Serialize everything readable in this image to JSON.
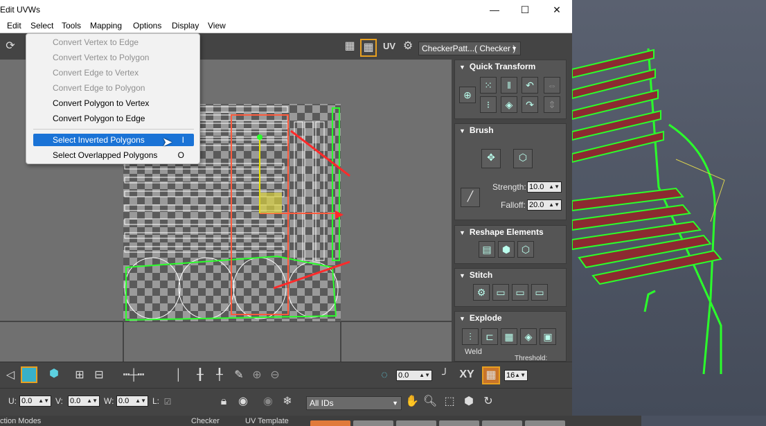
{
  "window": {
    "title": "Edit UVWs",
    "minimize": "—",
    "maximize": "☐",
    "close": "✕"
  },
  "menubar": [
    "Edit",
    "Select",
    "Tools",
    "Mapping",
    "Options",
    "Display",
    "View"
  ],
  "select_menu": {
    "items": [
      {
        "label": "Convert Vertex to Edge",
        "shortcut": "",
        "enabled": false
      },
      {
        "label": "Convert Vertex to Polygon",
        "shortcut": "",
        "enabled": false
      },
      {
        "label": "Convert Edge to Vertex",
        "shortcut": "",
        "enabled": false
      },
      {
        "label": "Convert Edge to Polygon",
        "shortcut": "",
        "enabled": false
      },
      {
        "label": "Convert Polygon to Vertex",
        "shortcut": "",
        "enabled": true
      },
      {
        "label": "Convert Polygon to Edge",
        "shortcut": "",
        "enabled": true
      },
      {
        "label": "Select Inverted Polygons",
        "shortcut": "I",
        "enabled": true,
        "highlighted": true
      },
      {
        "label": "Select Overlapped Polygons",
        "shortcut": "O",
        "enabled": true
      }
    ]
  },
  "toolbar": {
    "uv_label": "UV",
    "texture_combo": "CheckerPatt...( Checker )"
  },
  "rollouts": {
    "quick_transform": "Quick Transform",
    "brush": "Brush",
    "reshape": "Reshape Elements",
    "stitch": "Stitch",
    "explode": "Explode",
    "weld": "Weld",
    "threshold": "Threshold:"
  },
  "brush": {
    "strength_label": "Strength:",
    "strength_value": "10.0",
    "falloff_label": "Falloff:",
    "falloff_value": "20.0"
  },
  "bottom": {
    "rotate_value": "0.0",
    "xy_label": "XY",
    "grid_value": "16",
    "u_label": "U:",
    "u_value": "0.0",
    "v_label": "V:",
    "v_value": "0.0",
    "w_label": "W:",
    "w_value": "0.0",
    "l_label": "L:",
    "ids_combo": "All IDs"
  },
  "statusbar": {
    "left": "ction Modes",
    "checker": "Checker",
    "uv_template": "UV Template"
  },
  "colors": {
    "accent": "#e8a020",
    "highlight": "#1a73d6",
    "uv_green": "#2bff2b",
    "bench_wood": "#8c2a30"
  }
}
